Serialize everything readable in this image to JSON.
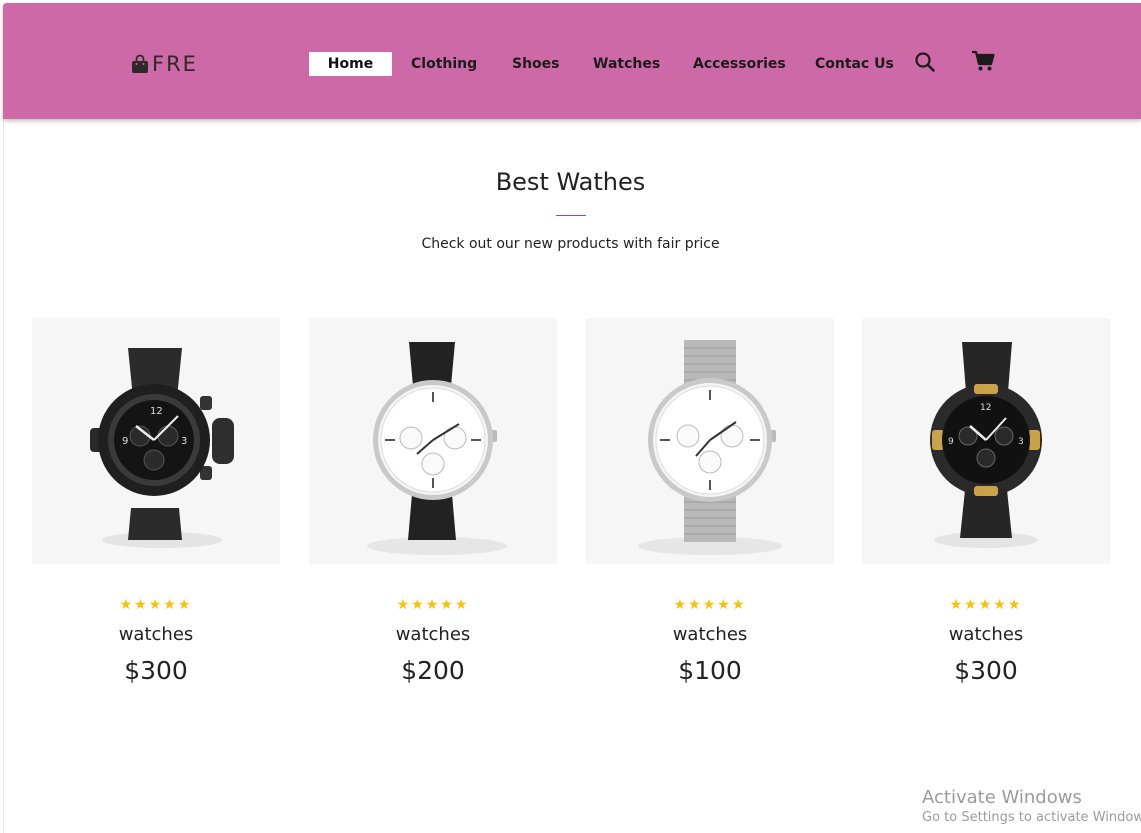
{
  "header": {
    "logo_text": "FRE",
    "background": "#cd69a6",
    "nav": [
      {
        "label": "Home",
        "active": true
      },
      {
        "label": "Clothing",
        "active": false
      },
      {
        "label": "Shoes",
        "active": false
      },
      {
        "label": "Watches",
        "active": false
      },
      {
        "label": "Accessories",
        "active": false
      },
      {
        "label": "Contac Us",
        "active": false
      }
    ],
    "icons": [
      "search-icon",
      "cart-icon"
    ]
  },
  "section": {
    "title": "Best Wathes",
    "subtitle": "Check out our new products with fair price",
    "underline_color": "#a8467f"
  },
  "products": [
    {
      "name": "watches",
      "price": "$300",
      "rating": 5,
      "image": "black-sport-watch"
    },
    {
      "name": "watches",
      "price": "$200",
      "rating": 5,
      "image": "white-dial-leather-watch"
    },
    {
      "name": "watches",
      "price": "$100",
      "rating": 5,
      "image": "white-dial-mesh-watch"
    },
    {
      "name": "watches",
      "price": "$300",
      "rating": 5,
      "image": "black-gold-chrono-watch"
    }
  ],
  "star_color": "#f5c300",
  "watermark": {
    "line1": "Activate Windows",
    "line2": "Go to Settings to activate Windows."
  }
}
